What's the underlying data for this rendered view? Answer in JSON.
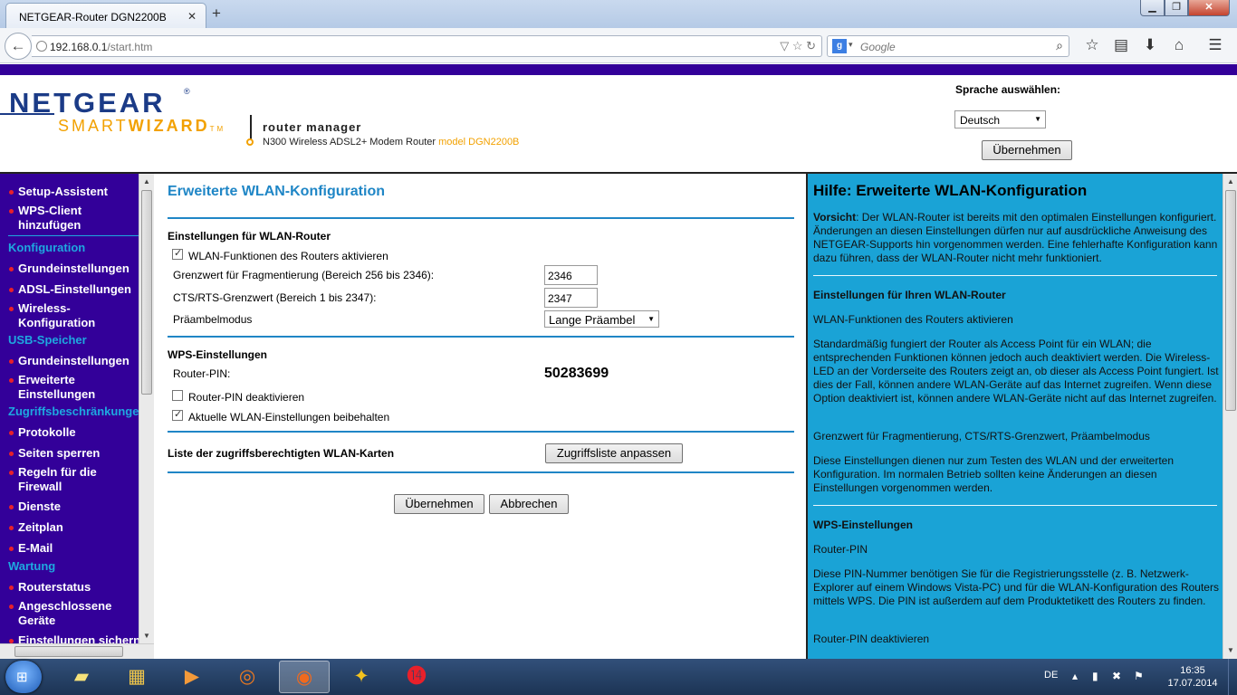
{
  "browser": {
    "tab_title": "NETGEAR-Router DGN2200B",
    "url_host": "192.168.0.1",
    "url_path": "/start.htm",
    "search_placeholder": "Google",
    "search_engine_letter": "g"
  },
  "header": {
    "brand": "NETGEAR",
    "registered_mark": "®",
    "smart": "SMART",
    "wizard": "WIZARD",
    "tm": "TM",
    "router_manager": "router manager",
    "model_line": "N300 Wireless ADSL2+ Modem Router",
    "model_name": "model DGN2200B",
    "language_label": "Sprache auswählen:",
    "language_value": "Deutsch",
    "apply_label": "Übernehmen"
  },
  "sidebar": {
    "items": [
      {
        "type": "item",
        "label": "Setup-Assistent"
      },
      {
        "type": "item",
        "label": "WPS-Client hinzufügen"
      },
      {
        "type": "section",
        "label": "Konfiguration"
      },
      {
        "type": "item",
        "label": "Grundeinstellungen"
      },
      {
        "type": "item",
        "label": "ADSL-Einstellungen"
      },
      {
        "type": "item",
        "label": "Wireless-Konfiguration"
      },
      {
        "type": "section",
        "label": "USB-Speicher"
      },
      {
        "type": "item",
        "label": "Grundeinstellungen"
      },
      {
        "type": "item",
        "label": "Erweiterte Einstellungen"
      },
      {
        "type": "section",
        "label": "Zugriffsbeschränkungen"
      },
      {
        "type": "item",
        "label": "Protokolle"
      },
      {
        "type": "item",
        "label": "Seiten sperren"
      },
      {
        "type": "item",
        "label": "Regeln für die Firewall"
      },
      {
        "type": "item",
        "label": "Dienste"
      },
      {
        "type": "item",
        "label": "Zeitplan"
      },
      {
        "type": "item",
        "label": "E-Mail"
      },
      {
        "type": "section",
        "label": "Wartung"
      },
      {
        "type": "item",
        "label": "Routerstatus"
      },
      {
        "type": "item",
        "label": "Angeschlossene Geräte"
      },
      {
        "type": "item",
        "label": "Einstellungen sichern"
      }
    ]
  },
  "main": {
    "title": "Erweiterte WLAN-Konfiguration",
    "router_section": "Einstellungen für WLAN-Router",
    "enable_wlan_label": "WLAN-Funktionen des Routers aktivieren",
    "enable_wlan_checked": true,
    "frag_label": "Grenzwert für Fragmentierung (Bereich 256 bis 2346):",
    "frag_value": "2346",
    "rts_label": "CTS/RTS-Grenzwert (Bereich 1 bis 2347):",
    "rts_value": "2347",
    "preamble_label": "Präambelmodus",
    "preamble_value": "Lange Präambel",
    "wps_section": "WPS-Einstellungen",
    "pin_label": "Router-PIN:",
    "pin_value": "50283699",
    "disable_pin_label": "Router-PIN deaktivieren",
    "disable_pin_checked": false,
    "keep_settings_label": "Aktuelle WLAN-Einstellungen beibehalten",
    "keep_settings_checked": true,
    "access_list_label": "Liste der zugriffsberechtigten WLAN-Karten",
    "access_list_button": "Zugriffsliste anpassen",
    "apply_button": "Übernehmen",
    "cancel_button": "Abbrechen"
  },
  "help": {
    "title": "Hilfe: Erweiterte WLAN-Konfiguration",
    "caution_bold": "Vorsicht",
    "caution_text": ": Der WLAN-Router ist bereits mit den optimalen Einstellungen konfiguriert. Änderungen an diesen Einstellungen dürfen nur auf ausdrückliche Anweisung des NETGEAR-Supports hin vorgenommen werden. Eine fehlerhafte Konfiguration kann dazu führen, dass der WLAN-Router nicht mehr funktioniert.",
    "router_heading": "Einstellungen für Ihren WLAN-Router",
    "enable_heading": "WLAN-Funktionen des Routers aktivieren",
    "enable_text": "Standardmäßig fungiert der Router als Access Point für ein WLAN; die entsprechenden Funktionen können jedoch auch deaktiviert werden. Die Wireless-LED an der Vorderseite des Routers zeigt an, ob dieser als Access Point fungiert. Ist dies der Fall, können andere WLAN-Geräte auf das Internet zugreifen. Wenn diese Option deaktiviert ist, können andere WLAN-Geräte nicht auf das Internet zugreifen.",
    "frag_heading": "Grenzwert für Fragmentierung, CTS/RTS-Grenzwert, Präambelmodus",
    "frag_text": "Diese Einstellungen dienen nur zum Testen des WLAN und der erweiterten Konfiguration. Im normalen Betrieb sollten keine Änderungen an diesen Einstellungen vorgenommen werden.",
    "wps_heading": "WPS-Einstellungen",
    "pin_heading": "Router-PIN",
    "pin_text": "Diese PIN-Nummer benötigen Sie für die Registrierungsstelle (z. B. Netzwerk-Explorer auf einem Windows Vista-PC) und für die WLAN-Konfiguration des Routers mittels WPS. Die PIN ist außerdem auf dem Produktetikett des Routers zu finden.",
    "disable_heading": "Router-PIN deaktivieren"
  },
  "taskbar": {
    "language": "DE",
    "time": "16:35",
    "date": "17.07.2014",
    "apps": [
      "sticky-notes-icon",
      "file-explorer-icon",
      "media-player-icon",
      "origin-icon",
      "firefox-icon",
      "game-icon",
      "app-14-icon"
    ]
  },
  "colors": {
    "sidebar_bg": "#330099",
    "accent_blue": "#1f86c6",
    "help_bg": "#1aa3d6",
    "bullet_red": "#e8202a"
  }
}
